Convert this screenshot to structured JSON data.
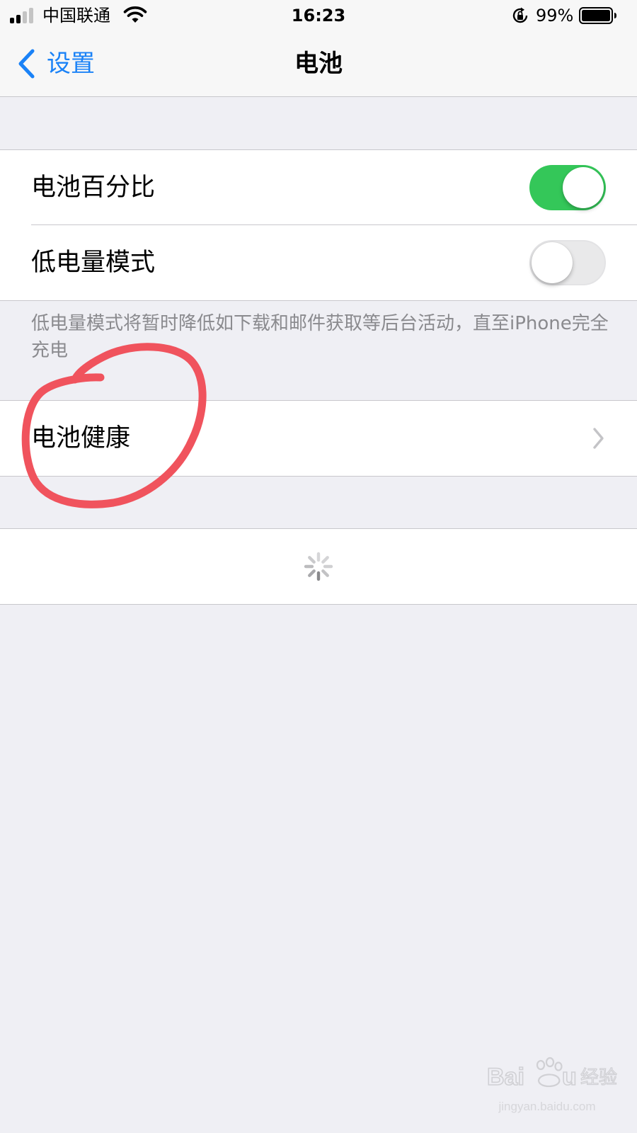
{
  "status_bar": {
    "carrier": "中国联通",
    "time": "16:23",
    "battery_percent": "99%"
  },
  "nav": {
    "back_label": "设置",
    "title": "电池"
  },
  "settings": {
    "battery_percentage": {
      "label": "电池百分比",
      "enabled": true
    },
    "low_power_mode": {
      "label": "低电量模式",
      "enabled": false
    },
    "low_power_footnote": "低电量模式将暂时降低如下载和邮件获取等后台活动，直至iPhone完全充电",
    "battery_health": {
      "label": "电池健康"
    }
  },
  "watermark": {
    "brand": "Baidu经验",
    "url": "jingyan.baidu.com"
  },
  "colors": {
    "accent": "#1a82f7",
    "toggle_on": "#34c759",
    "annotation": "#f0535d"
  },
  "icons": {
    "back": "chevron-left-icon",
    "disclosure": "chevron-right-icon",
    "loading": "spinner-icon",
    "wifi": "wifi-icon",
    "signal": "signal-icon",
    "orientation_lock": "orientation-lock-icon",
    "battery": "battery-icon"
  }
}
